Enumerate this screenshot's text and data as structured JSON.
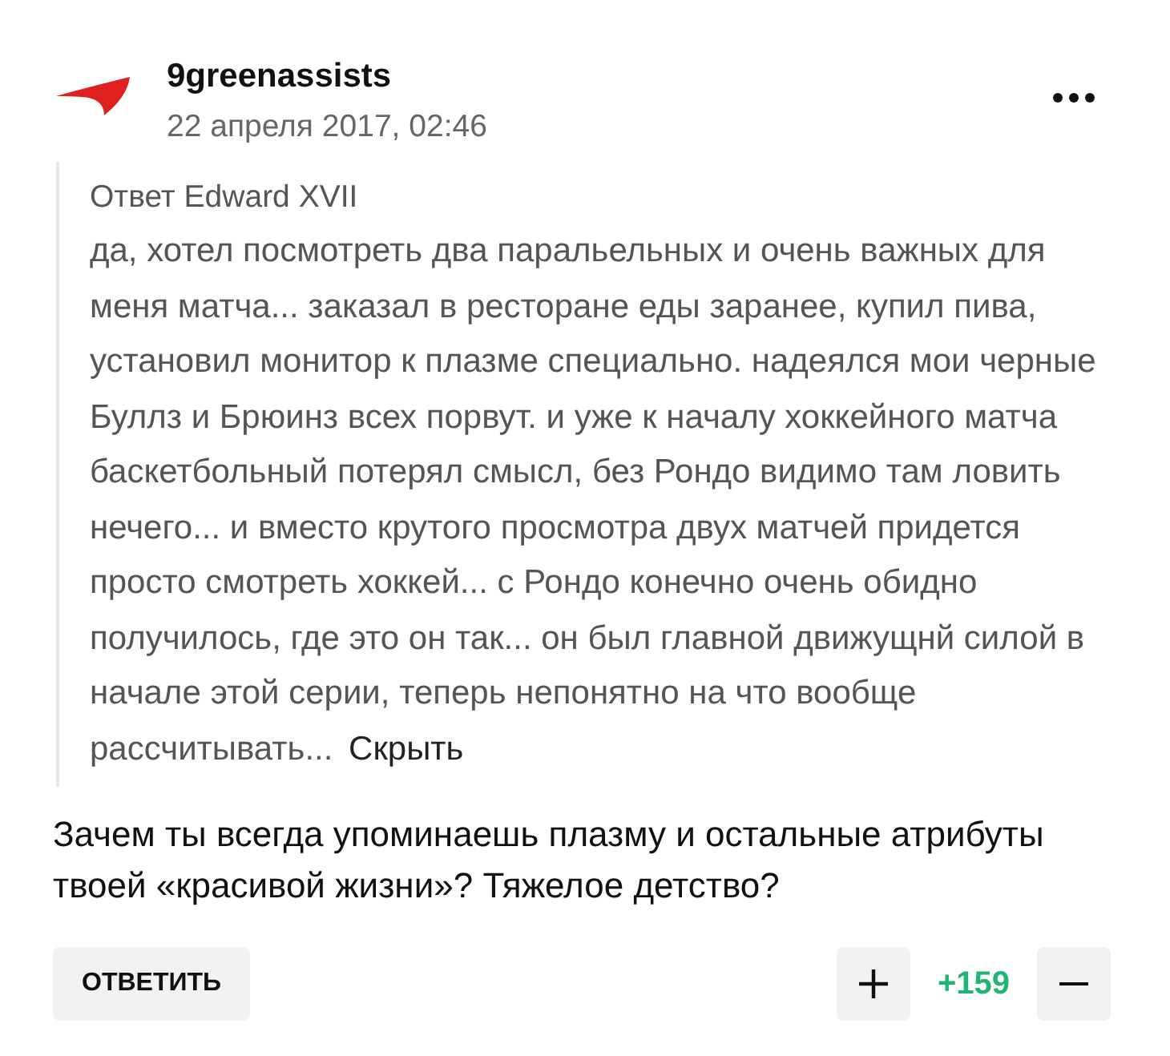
{
  "comment": {
    "author": "9greenassists",
    "date": "22 апреля 2017, 02:46",
    "quote": {
      "reply_to": "Ответ Edward XVII",
      "text": "да, хотел посмотреть два паральельных и очень важных для меня матча... заказал в ресторане еды заранее, купил пива, установил монитор к плазме специально. надеялся мои черные Буллз и Брюинз всех порвут. и уже к началу хоккейного матча баскетбольный потерял смысл, без Рондо видимо там ловить нечего... и вместо крутого просмотра двух матчей придется просто смотреть хоккей... с Рондо конечно очень обидно получилось, где это он так... он был главной движущнй силой в начале этой серии, теперь непонятно на что вообще рассчитывать...",
      "toggle": "Скрыть"
    },
    "text": "Зачем ты всегда упоминаешь плазму и остальные атрибуты твоей «красивой жизни»? Тяжелое детство?",
    "actions": {
      "reply": "ОТВЕТИТЬ",
      "score": "+159"
    }
  }
}
